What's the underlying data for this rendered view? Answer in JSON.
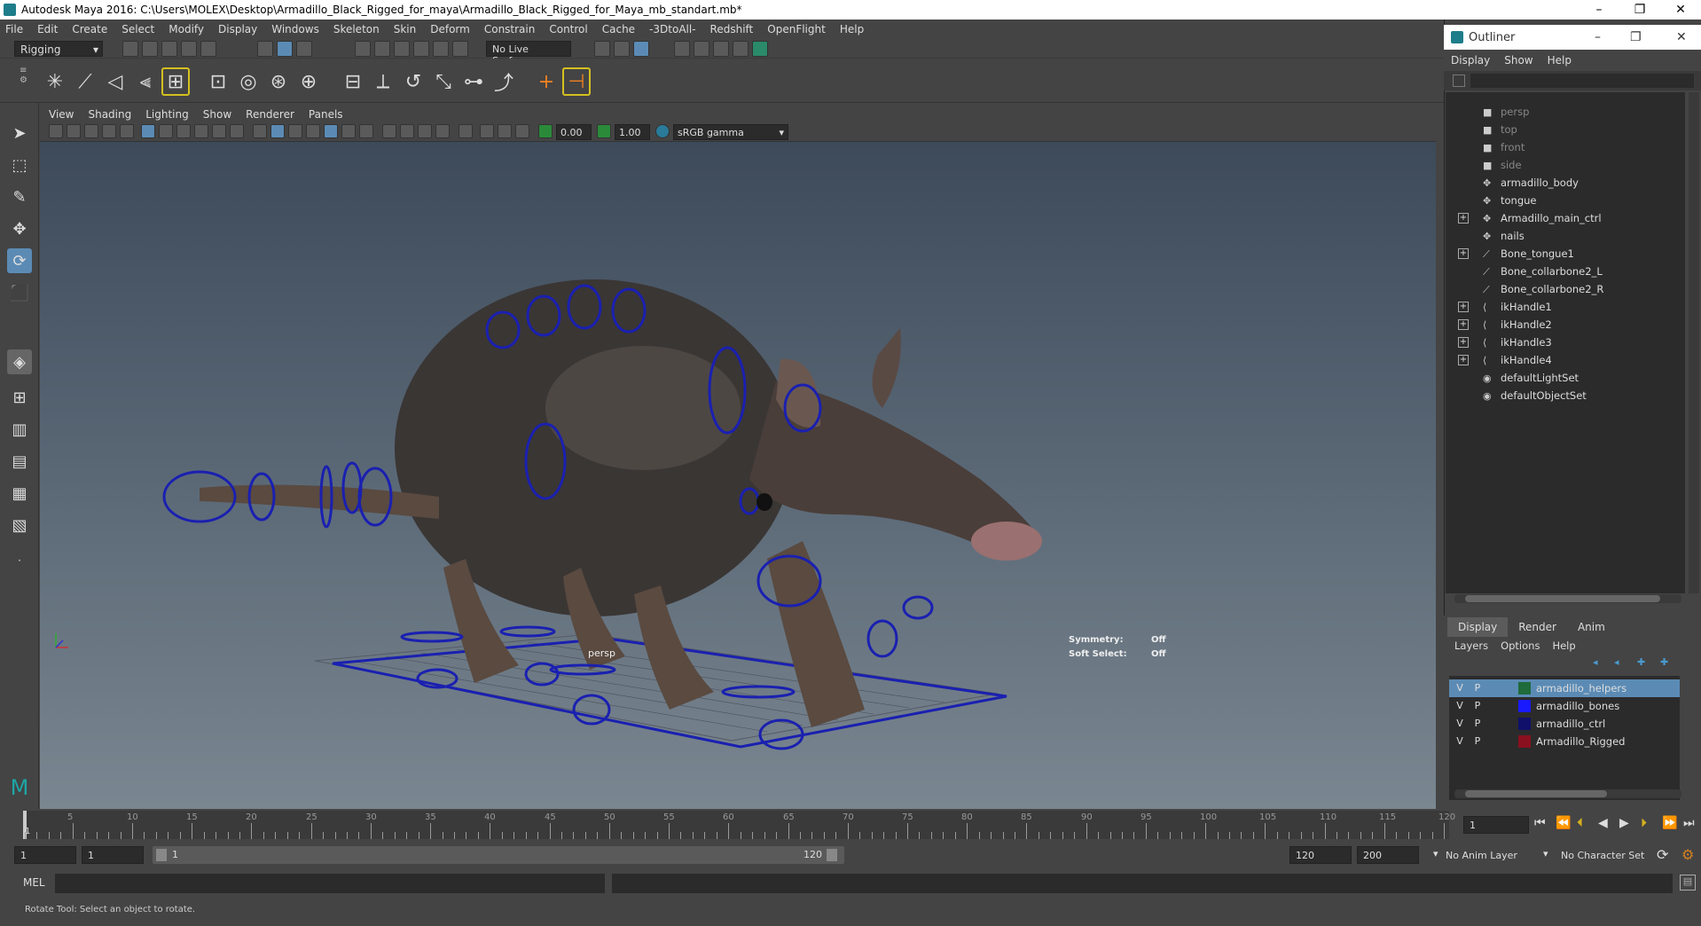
{
  "window": {
    "title": "Autodesk Maya 2016: C:\\Users\\MOLEX\\Desktop\\Armadillo_Black_Rigged_for_maya\\Armadillo_Black_Rigged_for_Maya_mb_standart.mb*",
    "minimize": "–",
    "restore": "❐",
    "close": "✕"
  },
  "menubar": [
    "File",
    "Edit",
    "Create",
    "Select",
    "Modify",
    "Display",
    "Windows",
    "Skeleton",
    "Skin",
    "Deform",
    "Constrain",
    "Control",
    "Cache",
    "-3DtoAll-",
    "Redshift",
    "OpenFlight",
    "Help"
  ],
  "statusline": {
    "mode": "Rigging",
    "live_surface": "No Live Surface"
  },
  "viewport": {
    "menus": [
      "View",
      "Shading",
      "Lighting",
      "Show",
      "Renderer",
      "Panels"
    ],
    "exposure": "0.00",
    "gamma": "1.00",
    "colorspace": "sRGB gamma",
    "camera": "persp",
    "symmetry_label": "Symmetry:",
    "symmetry_value": "Off",
    "softselect_label": "Soft Select:",
    "softselect_value": "Off"
  },
  "outliner": {
    "title": "Outliner",
    "menus": [
      "Display",
      "Show",
      "Help"
    ],
    "items": [
      {
        "label": "persp",
        "icon": "camera-icon",
        "dim": true,
        "expand": false
      },
      {
        "label": "top",
        "icon": "camera-icon",
        "dim": true,
        "expand": false
      },
      {
        "label": "front",
        "icon": "camera-icon",
        "dim": true,
        "expand": false
      },
      {
        "label": "side",
        "icon": "camera-icon",
        "dim": true,
        "expand": false
      },
      {
        "label": "armadillo_body",
        "icon": "mesh-icon",
        "dim": false,
        "expand": false
      },
      {
        "label": "tongue",
        "icon": "mesh-icon",
        "dim": false,
        "expand": false
      },
      {
        "label": "Armadillo_main_ctrl",
        "icon": "mesh-icon",
        "dim": false,
        "expand": true
      },
      {
        "label": "nails",
        "icon": "mesh-icon",
        "dim": false,
        "expand": false
      },
      {
        "label": "Bone_tongue1",
        "icon": "joint-icon",
        "dim": false,
        "expand": true
      },
      {
        "label": "Bone_collarbone2_L",
        "icon": "joint-icon",
        "dim": false,
        "expand": false
      },
      {
        "label": "Bone_collarbone2_R",
        "icon": "joint-icon",
        "dim": false,
        "expand": false
      },
      {
        "label": "ikHandle1",
        "icon": "ikhandle-icon",
        "dim": false,
        "expand": true
      },
      {
        "label": "ikHandle2",
        "icon": "ikhandle-icon",
        "dim": false,
        "expand": true
      },
      {
        "label": "ikHandle3",
        "icon": "ikhandle-icon",
        "dim": false,
        "expand": true
      },
      {
        "label": "ikHandle4",
        "icon": "ikhandle-icon",
        "dim": false,
        "expand": true
      },
      {
        "label": "defaultLightSet",
        "icon": "set-icon",
        "dim": false,
        "expand": false
      },
      {
        "label": "defaultObjectSet",
        "icon": "set-icon",
        "dim": false,
        "expand": false
      }
    ]
  },
  "layers": {
    "tabs": [
      "Display",
      "Render",
      "Anim"
    ],
    "menus": [
      "Layers",
      "Options",
      "Help"
    ],
    "rows": [
      {
        "v": "V",
        "p": "P",
        "color": "#1f6b3a",
        "name": "armadillo_helpers",
        "selected": true
      },
      {
        "v": "V",
        "p": "P",
        "color": "#1a1aff",
        "name": "armadillo_bones",
        "selected": false
      },
      {
        "v": "V",
        "p": "P",
        "color": "#10106b",
        "name": "armadillo_ctrl",
        "selected": false
      },
      {
        "v": "V",
        "p": "P",
        "color": "#8a1020",
        "name": "Armadillo_Rigged",
        "selected": false
      }
    ]
  },
  "timeline": {
    "ticks": [
      "5",
      "10",
      "15",
      "20",
      "25",
      "30",
      "35",
      "40",
      "45",
      "50",
      "55",
      "60",
      "65",
      "70",
      "75",
      "80",
      "85",
      "90",
      "95",
      "100",
      "105",
      "110",
      "115",
      "120"
    ],
    "start_marker": "1",
    "current_frame": "1"
  },
  "range": {
    "start": "1",
    "start2": "1",
    "slider_start": "1",
    "slider_end": "120",
    "end": "120",
    "end2": "200",
    "anim_layer": "No Anim Layer",
    "char_set": "No Character Set"
  },
  "cmdline": {
    "lang": "MEL"
  },
  "helpline": {
    "text": "Rotate Tool: Select an object to rotate."
  }
}
